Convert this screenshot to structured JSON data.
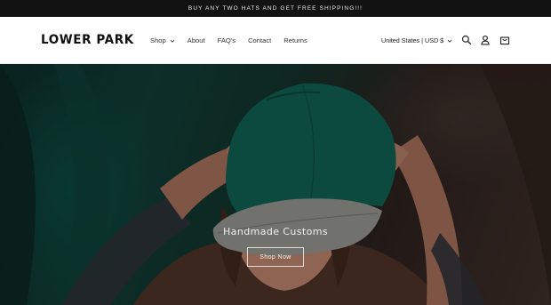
{
  "announcement": {
    "text": "BUY ANY TWO HATS AND GET FREE SHIPPING!!!"
  },
  "header": {
    "logo_text": "LOWER PARK",
    "nav": [
      {
        "label": "Shop",
        "has_dropdown": true
      },
      {
        "label": "About"
      },
      {
        "label": "FAQ's"
      },
      {
        "label": "Contact"
      },
      {
        "label": "Returns"
      }
    ],
    "country_selector": "United States | USD $",
    "icons": [
      "search-icon",
      "account-icon",
      "cart-icon"
    ]
  },
  "hero": {
    "title": "Handmade Customs",
    "cta_label": "Shop Now"
  },
  "colors": {
    "announcement_bg": "#121212",
    "hat_green": "#0f5b4e",
    "hat_brim": "#8a8c86",
    "text_dark": "#121212"
  }
}
